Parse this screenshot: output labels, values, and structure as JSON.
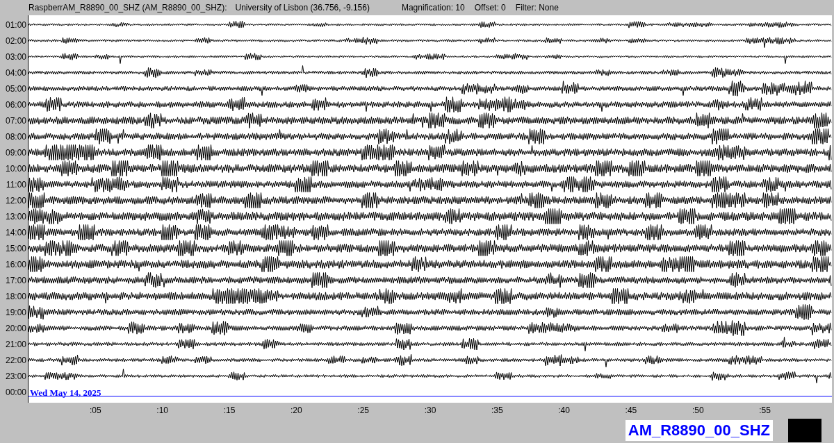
{
  "header": {
    "station": "RaspberrAM_R8890_00_SHZ (AM_R8890_00_SHZ):",
    "location": "University of Lisbon (36.756, -9.156)",
    "magnification": "Magnification: 10",
    "offset": "Offset: 0",
    "filter": "Filter: None"
  },
  "rows": [
    {
      "hour": "01:00",
      "kind": "trace"
    },
    {
      "hour": "02:00",
      "kind": "trace"
    },
    {
      "hour": "03:00",
      "kind": "trace"
    },
    {
      "hour": "04:00",
      "kind": "trace"
    },
    {
      "hour": "05:00",
      "kind": "trace"
    },
    {
      "hour": "06:00",
      "kind": "trace"
    },
    {
      "hour": "07:00",
      "kind": "trace"
    },
    {
      "hour": "08:00",
      "kind": "trace"
    },
    {
      "hour": "09:00",
      "kind": "trace"
    },
    {
      "hour": "10:00",
      "kind": "trace"
    },
    {
      "hour": "11:00",
      "kind": "trace"
    },
    {
      "hour": "12:00",
      "kind": "trace"
    },
    {
      "hour": "13:00",
      "kind": "trace"
    },
    {
      "hour": "14:00",
      "kind": "trace"
    },
    {
      "hour": "15:00",
      "kind": "trace"
    },
    {
      "hour": "16:00",
      "kind": "trace"
    },
    {
      "hour": "17:00",
      "kind": "trace"
    },
    {
      "hour": "18:00",
      "kind": "trace"
    },
    {
      "hour": "19:00",
      "kind": "trace"
    },
    {
      "hour": "20:00",
      "kind": "trace"
    },
    {
      "hour": "21:00",
      "kind": "trace"
    },
    {
      "hour": "22:00",
      "kind": "trace"
    },
    {
      "hour": "23:00",
      "kind": "trace"
    },
    {
      "hour": "00:00",
      "kind": "current",
      "date": "Wed May 14, 2025"
    }
  ],
  "minute_ticks": [
    ":05",
    ":10",
    ":15",
    ":20",
    ":25",
    ":30",
    ":35",
    ":40",
    ":45",
    ":50",
    ":55"
  ],
  "station_label": "AM_R8890_00_SHZ"
}
